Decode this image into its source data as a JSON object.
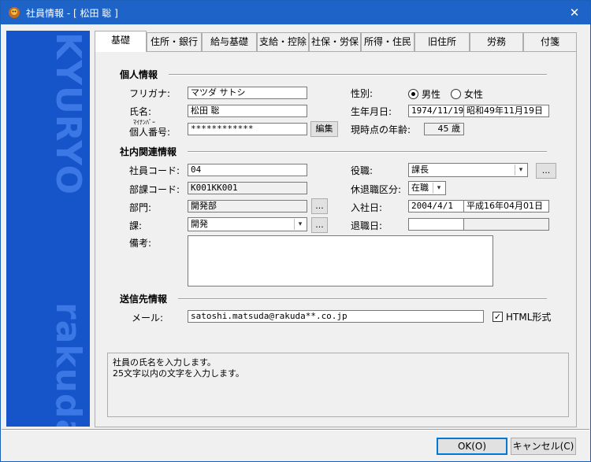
{
  "window": {
    "title": "社員情報 - [ 松田 聡 ]",
    "close_glyph": "✕"
  },
  "sidebar": {
    "logo_top": "KYURYO",
    "logo_bottom": "rakuda"
  },
  "tabs": [
    "基礎",
    "住所・銀行",
    "給与基礎",
    "支給・控除",
    "社保・労保",
    "所得・住民",
    "旧住所",
    "労務",
    "付箋"
  ],
  "active_tab": "基礎",
  "personal": {
    "heading": "個人情報",
    "furigana_label": "フリガナ:",
    "furigana_value": "マツダ サトシ",
    "name_label": "氏名:",
    "name_value": "松田 聡",
    "mynumber_small_label": "ﾏｲﾅﾝﾊﾞｰ",
    "mynumber_label": "個人番号:",
    "mynumber_value": "************",
    "edit_button": "編集",
    "gender_label": "性別:",
    "gender_options": [
      "男性",
      "女性"
    ],
    "gender_selected": "男性",
    "birth_label": "生年月日:",
    "birth_date": "1974/11/19",
    "birth_wareki": "昭和49年11月19日",
    "age_label": "現時点の年齢:",
    "age_value": "45 歳"
  },
  "company": {
    "heading": "社内関連情報",
    "emp_code_label": "社員コード:",
    "emp_code_value": "04",
    "dept_code_label": "部課コード:",
    "dept_code_value": "K001KK001",
    "dept_label": "部門:",
    "dept_value": "開発部",
    "section_label": "課:",
    "section_value": "開発",
    "notes_label": "備考:",
    "notes_value": "",
    "position_label": "役職:",
    "position_value": "課長",
    "status_label": "休退職区分:",
    "status_value": "在職",
    "join_label": "入社日:",
    "join_date": "2004/4/1",
    "join_wareki": "平成16年04月01日",
    "leave_label": "退職日:",
    "leave_date": "",
    "leave_wareki": "",
    "ellipsis": "..."
  },
  "contact": {
    "heading": "送信先情報",
    "mail_label": "メール:",
    "mail_value": "satoshi.matsuda@rakuda**.co.jp",
    "html_label": "HTML形式",
    "html_checked": true
  },
  "help": {
    "line1": "社員の氏名を入力します。",
    "line2": "25文字以内の文字を入力します。"
  },
  "buttons": {
    "ok": "OK(O)",
    "cancel": "キャンセル(C)"
  },
  "colors": {
    "titlebar": "#1d63c8",
    "sidebar": "#1655c9",
    "sidebar_text": "#3b78e6"
  }
}
